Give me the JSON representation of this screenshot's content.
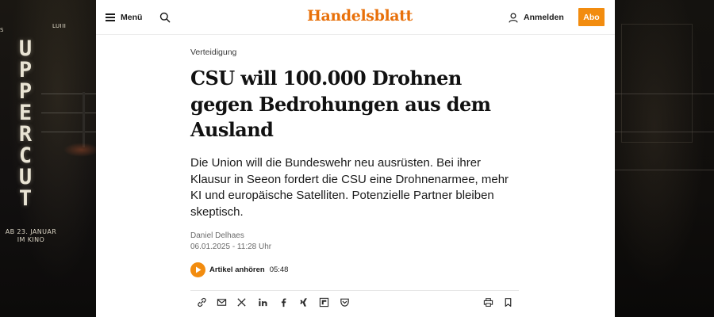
{
  "ad": {
    "left_tag": "S",
    "top_tag": "LUIII",
    "title": "UPPERCUT",
    "date_line1": "AB 23. JANUAR",
    "date_line2": "IM KINO"
  },
  "header": {
    "menu_label": "Menü",
    "search_icon": "search-icon",
    "logo": "Handelsblatt",
    "login_label": "Anmelden",
    "abo_label": "Abo",
    "accent_color": "#f28c0f"
  },
  "article": {
    "kicker": "Verteidigung",
    "headline": "CSU will 100.000 Drohnen gegen Bedrohungen aus dem Ausland",
    "teaser": "Die Union will die Bundeswehr neu ausrüsten. Bei ihrer Klausur in Seeon fordert die CSU eine Drohnenarmee, mehr KI und europäische Satelliten. Potenzielle Partner bleiben skeptisch.",
    "author": "Daniel Delhaes",
    "date": "06.01.2025 - 11:28 Uhr",
    "listen_label": "Artikel anhören",
    "listen_duration": "05:48"
  },
  "share_bar": {
    "icons": [
      "link-icon",
      "mail-icon",
      "x-icon",
      "linkedin-icon",
      "facebook-icon",
      "xing-icon",
      "flipboard-icon",
      "pocket-icon",
      "print-icon",
      "bookmark-icon"
    ]
  }
}
